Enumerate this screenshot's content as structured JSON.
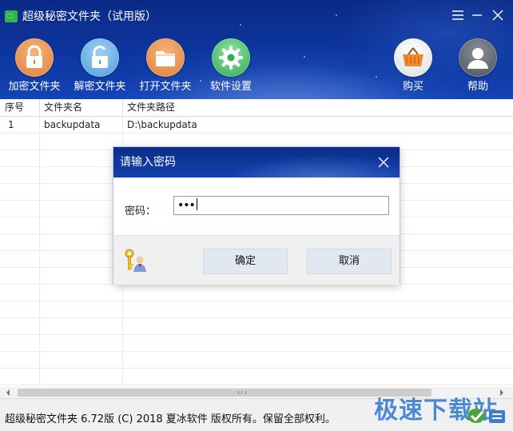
{
  "window": {
    "title": "超级秘密文件夹（试用版）",
    "icon": "app-logo-icon"
  },
  "toolbar": {
    "encrypt_folder": "加密文件夹",
    "decrypt_folder": "解密文件夹",
    "open_folder": "打开文件夹",
    "settings": "软件设置",
    "buy": "购买",
    "help": "帮助"
  },
  "table": {
    "columns": [
      "序号",
      "文件夹名",
      "文件夹路径"
    ],
    "rows": [
      {
        "index": "1",
        "name": "backupdata",
        "path": "D:\\backupdata"
      }
    ]
  },
  "dialog": {
    "title": "请输入密码",
    "password_label": "密码：",
    "password_value": "•••",
    "ok_label": "确定",
    "cancel_label": "取消"
  },
  "statusbar": {
    "text": "超级秘密文件夹 6.72版 (C) 2018 夏冰软件 版权所有。保留全部权利。"
  },
  "watermark": {
    "text": "极速下载站"
  },
  "colors": {
    "header_blue": "#0d36a0",
    "encrypt_orange": "#e27f3a",
    "decrypt_blue": "#4e9ddc",
    "settings_green": "#2fae58",
    "input_border": "#7da2ce"
  }
}
